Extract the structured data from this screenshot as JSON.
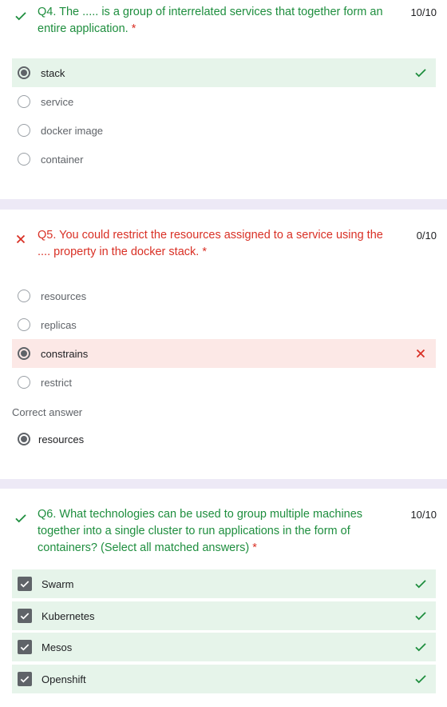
{
  "questions": [
    {
      "status": "correct",
      "title": "Q4. The ..... is a group of interrelated services that together form an entire application.",
      "required_mark": "*",
      "score": "10/10",
      "options": [
        {
          "label": "stack",
          "selected": true,
          "result": "correct"
        },
        {
          "label": "service",
          "selected": false,
          "result": ""
        },
        {
          "label": "docker image",
          "selected": false,
          "result": ""
        },
        {
          "label": "container",
          "selected": false,
          "result": ""
        }
      ]
    },
    {
      "status": "incorrect",
      "title": "Q5. You could restrict the resources assigned to a service using the .... property in the docker stack.",
      "required_mark": "*",
      "score": "0/10",
      "options": [
        {
          "label": "resources",
          "selected": false,
          "result": ""
        },
        {
          "label": "replicas",
          "selected": false,
          "result": ""
        },
        {
          "label": "constrains",
          "selected": true,
          "result": "incorrect"
        },
        {
          "label": "restrict",
          "selected": false,
          "result": ""
        }
      ],
      "correct_answer_heading": "Correct answer",
      "correct_answer": "resources"
    },
    {
      "status": "correct",
      "title": "Q6. What technologies can be used to group multiple machines together into a single cluster to run applications in the form of containers? (Select all matched answers)",
      "required_mark": "*",
      "score": "10/10",
      "options": [
        {
          "label": "Swarm",
          "checked": true,
          "result": "correct"
        },
        {
          "label": "Kubernetes",
          "checked": true,
          "result": "correct"
        },
        {
          "label": "Mesos",
          "checked": true,
          "result": "correct"
        },
        {
          "label": "Openshift",
          "checked": true,
          "result": "correct"
        }
      ]
    }
  ],
  "colors": {
    "correct": "#1e8e3e",
    "incorrect": "#d93025",
    "correct_bg": "#e6f4ea",
    "incorrect_bg": "#fce8e6",
    "page_bg": "#ede9f6"
  },
  "icons": {
    "correct": "check-icon",
    "incorrect": "cross-icon"
  }
}
